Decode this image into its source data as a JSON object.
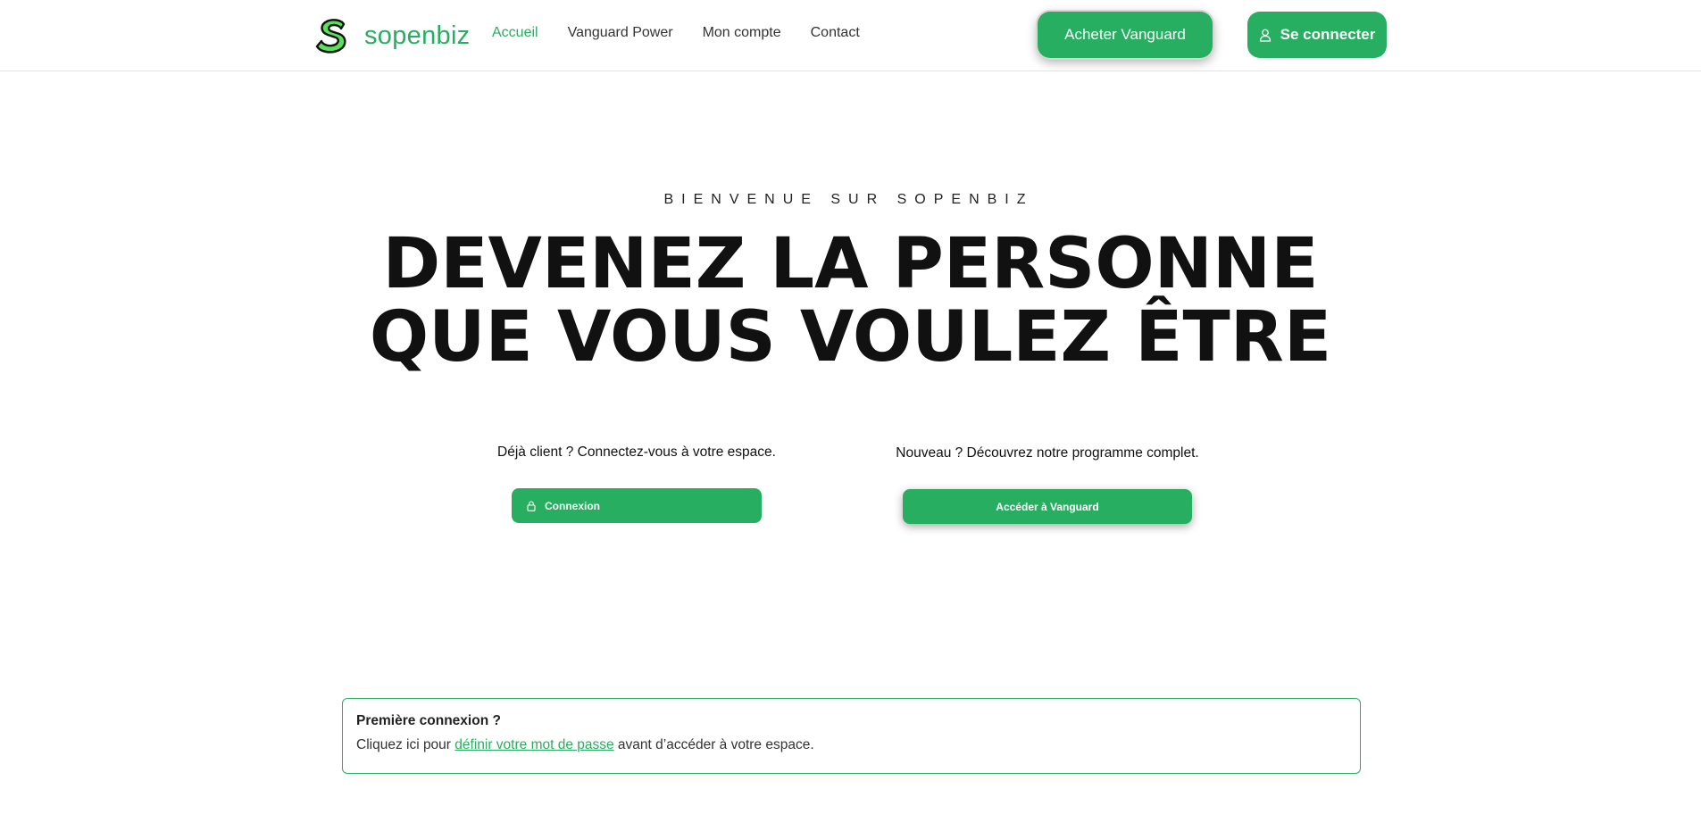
{
  "header": {
    "brand": "sopenbiz",
    "nav": [
      {
        "label": "Accueil",
        "active": true
      },
      {
        "label": "Vanguard Power",
        "active": false
      },
      {
        "label": "Mon compte",
        "active": false
      },
      {
        "label": "Contact",
        "active": false
      }
    ],
    "buy_button": "Acheter Vanguard",
    "login_button": "Se connecter",
    "login_icon": "user-icon"
  },
  "hero": {
    "kicker": "BIENVENUE SUR SOPENBIZ",
    "headline_line1": "DEVENEZ LA PERSONNE",
    "headline_line2": "QUE VOUS VOULEZ ÊTRE"
  },
  "existing_client": {
    "text": "Déjà client ? Connectez-vous à votre espace.",
    "button": "Connexion",
    "button_icon": "lock-icon"
  },
  "new_client": {
    "text": "Nouveau ? Découvrez notre programme complet.",
    "button": "Accéder à Vanguard"
  },
  "notice": {
    "title": "Première connexion ?",
    "prefix": "Cliquez ici pour ",
    "link": "définir votre mot de passe",
    "suffix": " avant d’accéder à votre espace."
  },
  "colors": {
    "accent": "#27ae60",
    "text": "#111111"
  }
}
